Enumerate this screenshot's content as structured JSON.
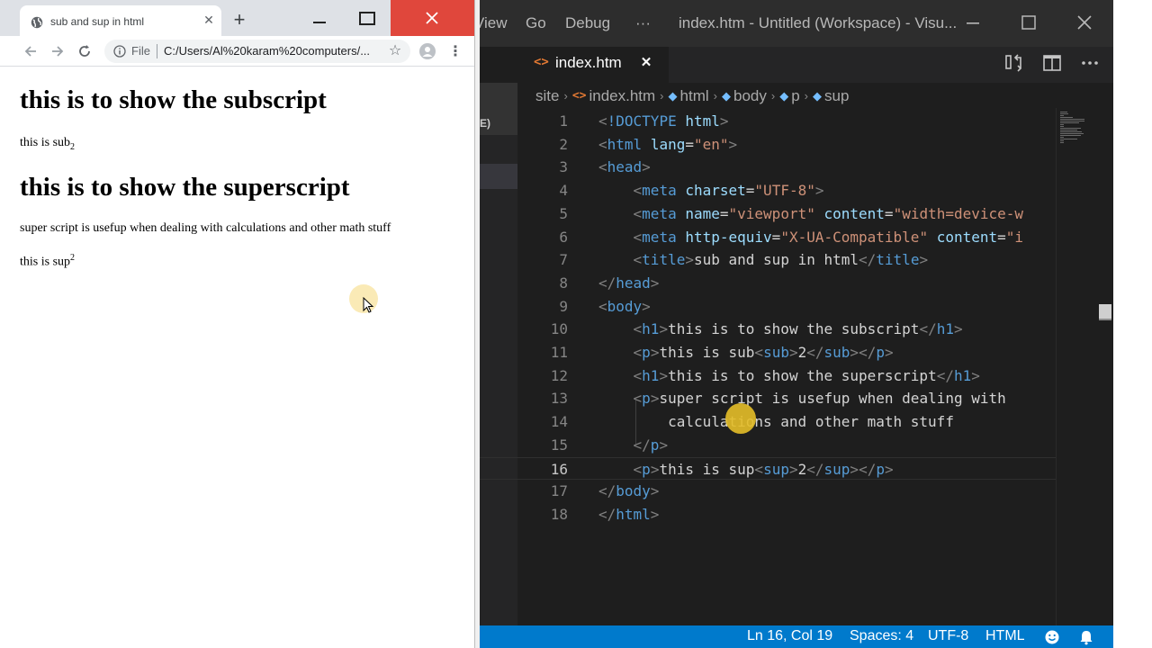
{
  "chrome": {
    "tab_title": "sub and sup in html",
    "url_scheme": "File",
    "url": "C:/Users/Al%20karam%20computers/...",
    "icons": {
      "tab_favicon": "globe-icon",
      "close_tab": "close-icon",
      "new_tab": "plus-icon",
      "back": "arrow-left-icon",
      "forward": "arrow-right-icon",
      "reload": "reload-icon",
      "info": "info-icon",
      "bookmark": "star-icon",
      "profile": "avatar-icon",
      "menu": "kebab-menu-icon"
    },
    "page": {
      "h1_subscript": "this is to show the subscript",
      "p_sub_text": "this is sub",
      "p_sub_value": "2",
      "h1_superscript": "this is to show the superscript",
      "p_super_text": "super script is usefup when dealing with calculations and other math stuff",
      "p_sup_text": "this is sup",
      "p_sup_value": "2"
    }
  },
  "vscode": {
    "menu": [
      "View",
      "Go",
      "Debug",
      "···"
    ],
    "window_title": "index.htm - Untitled (Workspace) - Visu...",
    "tab": {
      "label": "index.htm",
      "icon": "html-file-icon"
    },
    "sidebar_fragment": "E)",
    "breadcrumb": [
      "site",
      "index.htm",
      "html",
      "body",
      "p",
      "sup"
    ],
    "status": {
      "position": "Ln 16, Col 19",
      "spaces": "Spaces: 4",
      "encoding": "UTF-8",
      "language": "HTML",
      "feedback_icon": "smiley-icon",
      "bell_icon": "bell-icon"
    },
    "current_line": 16,
    "colors": {
      "tag": "#569cd6",
      "attr": "#9cdcfe",
      "string": "#ce9178",
      "statusbar": "#007acc"
    },
    "code_lines": [
      {
        "n": "1",
        "tokens": [
          [
            "pun",
            "<"
          ],
          [
            "tag",
            "!DOCTYPE"
          ],
          [
            "txt",
            " "
          ],
          [
            "attr",
            "html"
          ],
          [
            "pun",
            ">"
          ]
        ]
      },
      {
        "n": "2",
        "tokens": [
          [
            "pun",
            "<"
          ],
          [
            "tag",
            "html"
          ],
          [
            "txt",
            " "
          ],
          [
            "attr",
            "lang"
          ],
          [
            "txt",
            "="
          ],
          [
            "str",
            "\"en\""
          ],
          [
            "pun",
            ">"
          ]
        ]
      },
      {
        "n": "3",
        "tokens": [
          [
            "pun",
            "<"
          ],
          [
            "tag",
            "head"
          ],
          [
            "pun",
            ">"
          ]
        ]
      },
      {
        "n": "4",
        "tokens": [
          [
            "txt",
            "    "
          ],
          [
            "pun",
            "<"
          ],
          [
            "tag",
            "meta"
          ],
          [
            "txt",
            " "
          ],
          [
            "attr",
            "charset"
          ],
          [
            "txt",
            "="
          ],
          [
            "str",
            "\"UTF-8\""
          ],
          [
            "pun",
            ">"
          ]
        ]
      },
      {
        "n": "5",
        "tokens": [
          [
            "txt",
            "    "
          ],
          [
            "pun",
            "<"
          ],
          [
            "tag",
            "meta"
          ],
          [
            "txt",
            " "
          ],
          [
            "attr",
            "name"
          ],
          [
            "txt",
            "="
          ],
          [
            "str",
            "\"viewport\""
          ],
          [
            "txt",
            " "
          ],
          [
            "attr",
            "content"
          ],
          [
            "txt",
            "="
          ],
          [
            "str",
            "\"width=device-w"
          ]
        ]
      },
      {
        "n": "6",
        "tokens": [
          [
            "txt",
            "    "
          ],
          [
            "pun",
            "<"
          ],
          [
            "tag",
            "meta"
          ],
          [
            "txt",
            " "
          ],
          [
            "attr",
            "http-equiv"
          ],
          [
            "txt",
            "="
          ],
          [
            "str",
            "\"X-UA-Compatible\""
          ],
          [
            "txt",
            " "
          ],
          [
            "attr",
            "content"
          ],
          [
            "txt",
            "="
          ],
          [
            "str",
            "\"i"
          ]
        ]
      },
      {
        "n": "7",
        "tokens": [
          [
            "txt",
            "    "
          ],
          [
            "pun",
            "<"
          ],
          [
            "tag",
            "title"
          ],
          [
            "pun",
            ">"
          ],
          [
            "txt",
            "sub and sup in html"
          ],
          [
            "pun",
            "</"
          ],
          [
            "tag",
            "title"
          ],
          [
            "pun",
            ">"
          ]
        ]
      },
      {
        "n": "8",
        "tokens": [
          [
            "pun",
            "</"
          ],
          [
            "tag",
            "head"
          ],
          [
            "pun",
            ">"
          ]
        ]
      },
      {
        "n": "9",
        "tokens": [
          [
            "pun",
            "<"
          ],
          [
            "tag",
            "body"
          ],
          [
            "pun",
            ">"
          ]
        ]
      },
      {
        "n": "10",
        "tokens": [
          [
            "txt",
            "    "
          ],
          [
            "pun",
            "<"
          ],
          [
            "tag",
            "h1"
          ],
          [
            "pun",
            ">"
          ],
          [
            "txt",
            "this is to show the subscript"
          ],
          [
            "pun",
            "</"
          ],
          [
            "tag",
            "h1"
          ],
          [
            "pun",
            ">"
          ]
        ]
      },
      {
        "n": "11",
        "tokens": [
          [
            "txt",
            "    "
          ],
          [
            "pun",
            "<"
          ],
          [
            "tag",
            "p"
          ],
          [
            "pun",
            ">"
          ],
          [
            "txt",
            "this is sub"
          ],
          [
            "pun",
            "<"
          ],
          [
            "tag",
            "sub"
          ],
          [
            "pun",
            ">"
          ],
          [
            "txt",
            "2"
          ],
          [
            "pun",
            "</"
          ],
          [
            "tag",
            "sub"
          ],
          [
            "pun",
            ">"
          ],
          [
            "pun",
            "</"
          ],
          [
            "tag",
            "p"
          ],
          [
            "pun",
            ">"
          ]
        ]
      },
      {
        "n": "12",
        "tokens": [
          [
            "txt",
            "    "
          ],
          [
            "pun",
            "<"
          ],
          [
            "tag",
            "h1"
          ],
          [
            "pun",
            ">"
          ],
          [
            "txt",
            "this is to show the superscript"
          ],
          [
            "pun",
            "</"
          ],
          [
            "tag",
            "h1"
          ],
          [
            "pun",
            ">"
          ]
        ]
      },
      {
        "n": "13",
        "tokens": [
          [
            "txt",
            "    "
          ],
          [
            "pun",
            "<"
          ],
          [
            "tag",
            "p"
          ],
          [
            "pun",
            ">"
          ],
          [
            "txt",
            "super script is usefup when dealing with"
          ]
        ]
      },
      {
        "n": "14",
        "tokens": [
          [
            "txt",
            "        calculations and other math stuff"
          ]
        ]
      },
      {
        "n": "15",
        "tokens": [
          [
            "txt",
            "    "
          ],
          [
            "pun",
            "</"
          ],
          [
            "tag",
            "p"
          ],
          [
            "pun",
            ">"
          ]
        ]
      },
      {
        "n": "16",
        "tokens": [
          [
            "txt",
            "    "
          ],
          [
            "pun",
            "<"
          ],
          [
            "tag",
            "p"
          ],
          [
            "pun",
            ">"
          ],
          [
            "txt",
            "this is sup"
          ],
          [
            "pun",
            "<"
          ],
          [
            "tag",
            "sup"
          ],
          [
            "pun",
            ">"
          ],
          [
            "txt",
            "2"
          ],
          [
            "pun",
            "</"
          ],
          [
            "tag",
            "sup"
          ],
          [
            "pun",
            ">"
          ],
          [
            "pun",
            "</"
          ],
          [
            "tag",
            "p"
          ],
          [
            "pun",
            ">"
          ]
        ]
      },
      {
        "n": "17",
        "tokens": [
          [
            "pun",
            "</"
          ],
          [
            "tag",
            "body"
          ],
          [
            "pun",
            ">"
          ]
        ]
      },
      {
        "n": "18",
        "tokens": [
          [
            "pun",
            "</"
          ],
          [
            "tag",
            "html"
          ],
          [
            "pun",
            ">"
          ]
        ]
      }
    ]
  }
}
